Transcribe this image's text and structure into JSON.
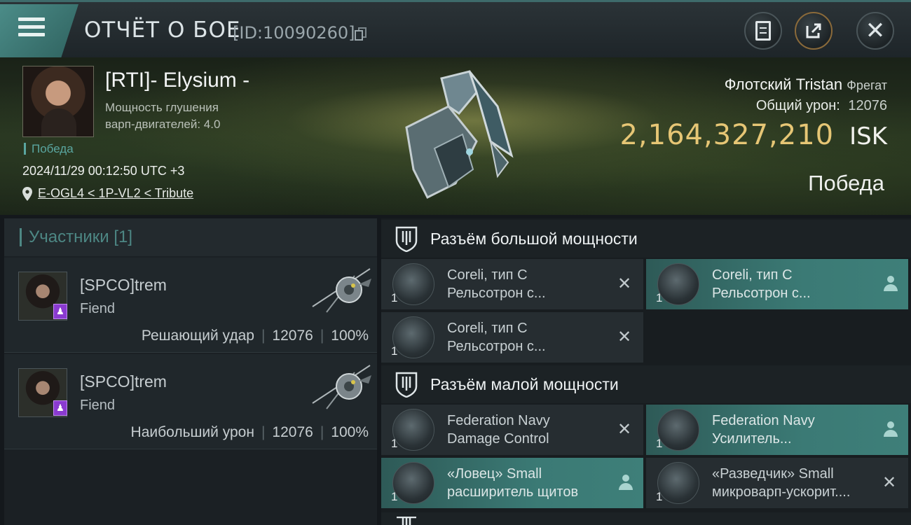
{
  "header": {
    "title": "ОТЧЁТ О БОЕ",
    "report_id": "[ID:10090260]"
  },
  "victim": {
    "pilot": "[RTI]- Elysium -",
    "warp_label_line1": "Мощность глушения",
    "warp_label_line2": "варп-двигателей: 4.0",
    "status_tag": "Победа",
    "datetime": "2024/11/29 00:12:50 UTC +3",
    "location": "E-OGL4 < 1P-VL2 < Tribute",
    "ship_name": "Флотский Tristan",
    "ship_class": "Фрегат",
    "damage_label": "Общий урон:",
    "damage_value": "12076",
    "isk_value": "2,164,327,210",
    "isk_currency": "ISK",
    "result": "Победа"
  },
  "participants": {
    "header": "Участники [1]",
    "items": [
      {
        "name": "[SPCO]trem",
        "ship": "Fiend",
        "role": "Решающий удар",
        "damage": "12076",
        "percent": "100%"
      },
      {
        "name": "[SPCO]trem",
        "ship": "Fiend",
        "role": "Наибольший урон",
        "damage": "12076",
        "percent": "100%"
      }
    ]
  },
  "fitting": {
    "high_slot_label": "Разъём большой мощности",
    "low_slot_label": "Разъём малой мощности",
    "high": [
      {
        "line1": "Coreli, тип C",
        "line2": "Рельсотрон с...",
        "qty": "1",
        "state": "destroyed",
        "icon": "railgun-icon"
      },
      {
        "line1": "Coreli, тип C",
        "line2": "Рельсотрон с...",
        "qty": "1",
        "state": "dropped",
        "icon": "railgun-icon"
      },
      {
        "line1": "Coreli, тип C",
        "line2": "Рельсотрон с...",
        "qty": "1",
        "state": "destroyed",
        "icon": "railgun-icon"
      }
    ],
    "low": [
      {
        "line1": "Federation Navy",
        "line2": "Damage Control",
        "qty": "1",
        "state": "destroyed",
        "icon": "damage-control-icon"
      },
      {
        "line1": "Federation Navy",
        "line2": "Усилитель...",
        "qty": "1",
        "state": "dropped",
        "icon": "amplifier-icon"
      },
      {
        "line1": "«Ловец» Small",
        "line2": "расширитель щитов",
        "qty": "1",
        "state": "dropped",
        "icon": "shield-extender-icon"
      },
      {
        "line1": "«Разведчик» Small",
        "line2": "микроварп-ускорит....",
        "qty": "1",
        "state": "destroyed",
        "icon": "microwarp-icon"
      }
    ]
  },
  "colors": {
    "accent": "#4d8784",
    "isk": "#e6c675",
    "owned_module": "#3b7a75",
    "drone_badge": "#8a3ad0"
  }
}
